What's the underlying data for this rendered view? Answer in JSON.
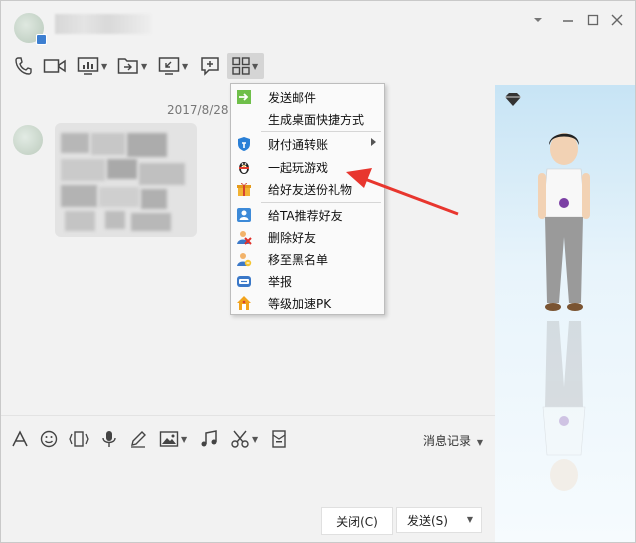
{
  "chat": {
    "timestamp": "2017/8/28"
  },
  "context_menu": {
    "items": [
      {
        "label": "发送邮件",
        "icon": "send-mail-icon"
      },
      {
        "label": "生成桌面快捷方式",
        "icon": ""
      },
      {
        "label": "财付通转账",
        "icon": "tenpay-shield-icon",
        "submenu": true
      },
      {
        "label": "一起玩游戏",
        "icon": "game-penguin-icon"
      },
      {
        "label": "给好友送份礼物",
        "icon": "gift-icon"
      },
      {
        "label": "给TA推荐好友",
        "icon": "recommend-friend-icon"
      },
      {
        "label": "删除好友",
        "icon": "delete-friend-icon"
      },
      {
        "label": "移至黑名单",
        "icon": "blacklist-icon"
      },
      {
        "label": "举报",
        "icon": "report-icon"
      },
      {
        "label": "等级加速PK",
        "icon": "level-pk-icon"
      }
    ]
  },
  "input_toolbar": {
    "history_label": "消息记录"
  },
  "buttons": {
    "close_label": "关闭(C)",
    "send_label": "发送(S)"
  },
  "colors": {
    "accent_red": "#e8362e",
    "menu_bg": "#fafafa",
    "window_bg": "#f2f2f2"
  }
}
